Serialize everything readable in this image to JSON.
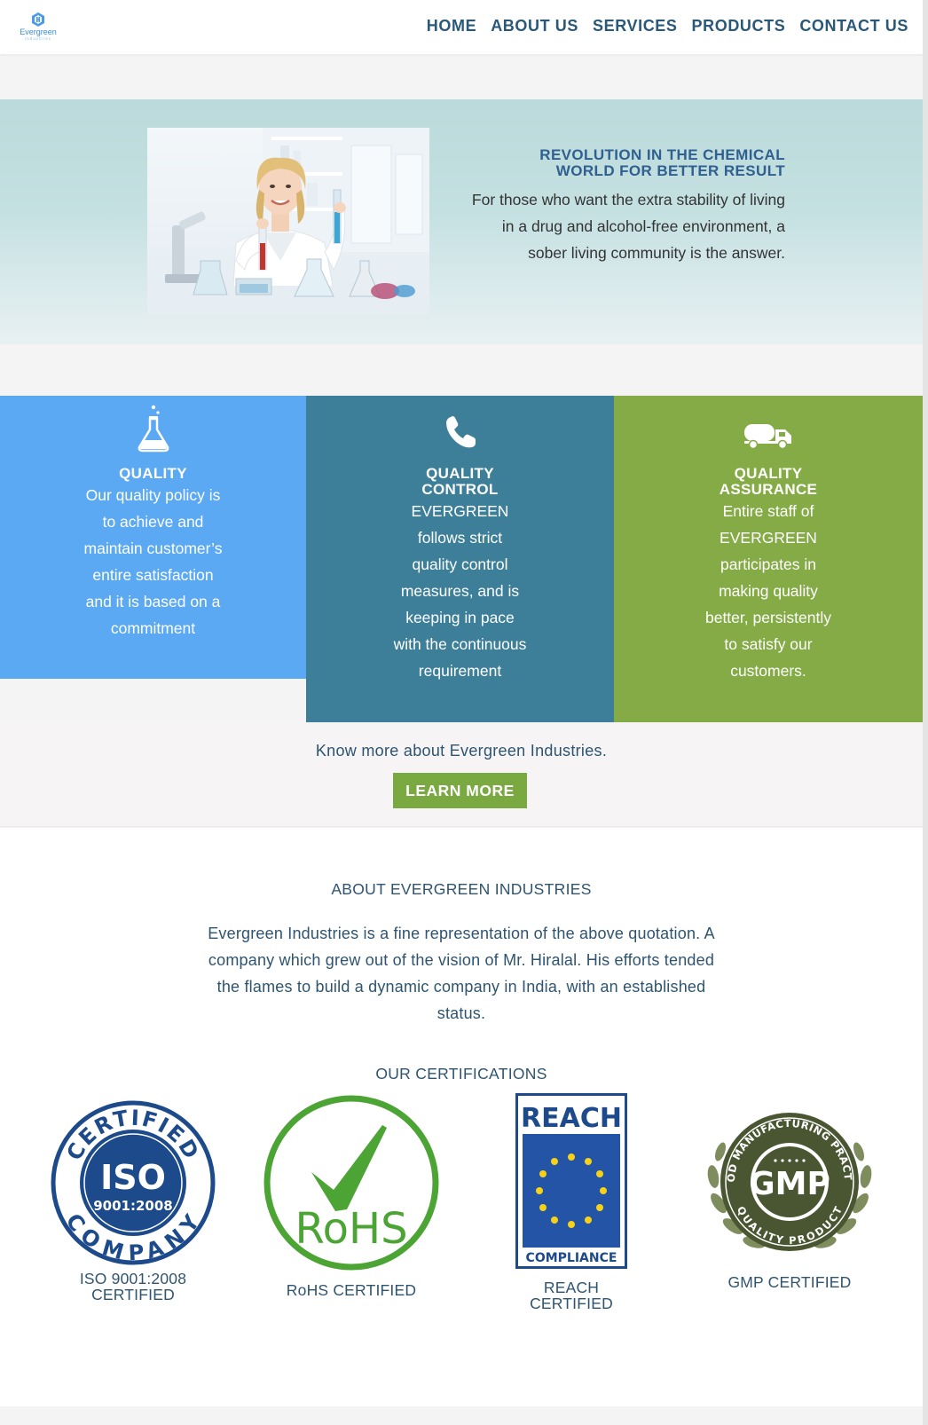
{
  "header": {
    "logo_text": "Evergreen",
    "logo_subtext": "industries",
    "nav": [
      "HOME",
      "ABOUT US",
      "SERVICES",
      "PRODUCTS",
      "CONTACT US"
    ]
  },
  "hero": {
    "title_line1": "REVOLUTION IN THE CHEMICAL",
    "title_line2": "WORLD FOR BETTER RESULT",
    "body": "For those who want the extra stability of living in a drug and alcohol-free environment, a sober living community is the answer."
  },
  "features": [
    {
      "icon": "flask-icon",
      "title": "QUALITY",
      "body": "Our quality policy is to achieve and maintain customer’s entire satisfaction and it is based on a commitment",
      "color": "#5aa9f2"
    },
    {
      "icon": "phone-icon",
      "title_line1": "QUALITY",
      "title_line2": "CONTROL",
      "body": "EVERGREEN follows strict quality control measures, and is keeping in pace with the continuous requirement",
      "color": "#3d7f99"
    },
    {
      "icon": "truck-icon",
      "title_line1": "QUALITY",
      "title_line2": "ASSURANCE",
      "body": "Entire staff of EVERGREEN participates in making quality better, persistently to satisfy our customers.",
      "color": "#84ab45"
    }
  ],
  "cta": {
    "text": "Know more about Evergreen Industries.",
    "button_label": "LEARN MORE",
    "button_color": "#7aa841"
  },
  "about": {
    "heading": "ABOUT EVERGREEN INDUSTRIES",
    "body": "Evergreen Industries is a fine representation of the above quotation. A company which grew out of the vision of Mr. Hiralal. His efforts tended the flames to build a dynamic company in India, with an established status."
  },
  "certifications": {
    "heading": "OUR CERTIFICATIONS",
    "items": [
      {
        "label": "ISO 9001:2008 CERTIFIED",
        "logo_top": "CERTIFIED",
        "logo_mid": "ISO",
        "logo_num": "9001:2008",
        "logo_bottom": "COMPANY"
      },
      {
        "label": "RoHS CERTIFIED",
        "logo_text": "RoHS"
      },
      {
        "label": "REACH CERTIFIED",
        "logo_top": "REACH",
        "logo_bottom": "COMPLIANCE"
      },
      {
        "label": "GMP CERTIFIED",
        "logo_top": "GOOD MANUFACTURING PRACTICE",
        "logo_mid": "GMP",
        "logo_bottom": "QUALITY PRODUCT"
      }
    ]
  }
}
